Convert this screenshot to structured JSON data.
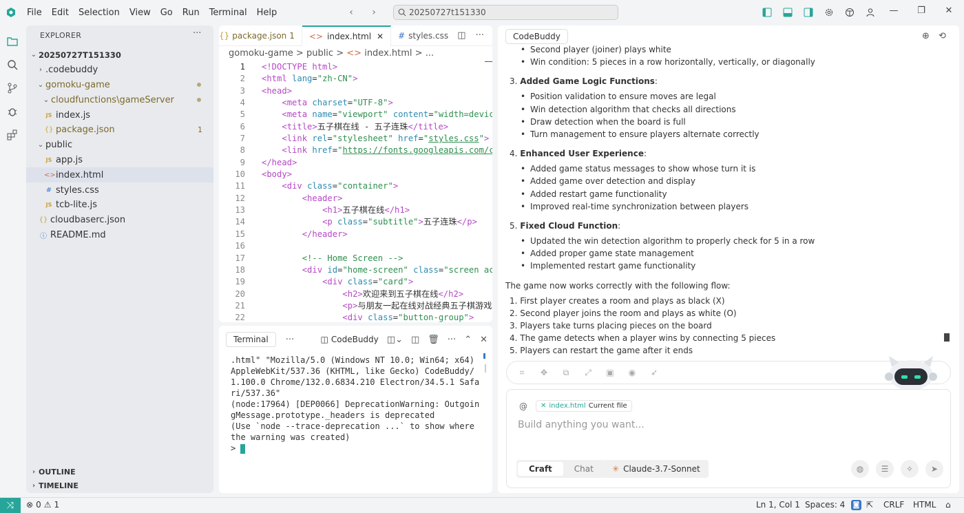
{
  "menu": [
    "File",
    "Edit",
    "Selection",
    "View",
    "Go",
    "Run",
    "Terminal",
    "Help"
  ],
  "search": {
    "text": "20250727t151330"
  },
  "explorer": {
    "title": "EXPLORER",
    "root": "20250727T151330",
    "items": [
      {
        "label": ".codebuddy",
        "icon": "chevron-right"
      },
      {
        "label": "gomoku-game",
        "icon": "chevron-down"
      },
      {
        "label": "cloudfunctions\\gameServer",
        "icon": "chevron-down"
      },
      {
        "label": "index.js",
        "icon": "js"
      },
      {
        "label": "package.json",
        "icon": "json",
        "count": "1"
      },
      {
        "label": "public",
        "icon": "chevron-down"
      },
      {
        "label": "app.js",
        "icon": "js"
      },
      {
        "label": "index.html",
        "icon": "html"
      },
      {
        "label": "styles.css",
        "icon": "css"
      },
      {
        "label": "tcb-lite.js",
        "icon": "js"
      },
      {
        "label": "cloudbaserc.json",
        "icon": "json"
      },
      {
        "label": "README.md",
        "icon": "info"
      }
    ],
    "outline": "OUTLINE",
    "timeline": "TIMELINE"
  },
  "editor": {
    "tabs": [
      "package.json",
      "1",
      "index.html",
      "styles.css"
    ],
    "breadcrumb": [
      "gomoku-game",
      ">",
      "public",
      ">",
      "index.html",
      ">",
      "..."
    ],
    "lines": [
      "1",
      "2",
      "3",
      "4",
      "5",
      "6",
      "7",
      "8",
      "9",
      "10",
      "11",
      "12",
      "13",
      "14",
      "15",
      "16",
      "17",
      "18",
      "19",
      "20",
      "21",
      "22"
    ]
  },
  "terminal": {
    "tab": "Terminal",
    "codebuddy": "CodeBuddy",
    "output": ".html\" \"Mozilla/5.0 (Windows NT 10.0; Win64; x64) AppleWebKit/537.36 (KHTML, like Gecko) CodeBuddy/1.100.0 Chrome/132.0.6834.210 Electron/34.5.1 Safari/537.36\"\n(node:17964) [DEP0066] DeprecationWarning: OutgoingMessage.prototype._headers is deprecated\n(Use `node --trace-deprecation ...` to show where the warning was created)",
    "prompt": ">"
  },
  "chat": {
    "tab": "CodeBuddy",
    "top_bullets": [
      "Second player (joiner) plays white",
      "Win condition: 5 pieces in a row horizontally, vertically, or diagonally"
    ],
    "s3": {
      "num": "3.",
      "title": "Added Game Logic Functions",
      "colon": ":",
      "items": [
        "Position validation to ensure moves are legal",
        "Win detection algorithm that checks all directions",
        "Draw detection when the board is full",
        "Turn management to ensure players alternate correctly"
      ]
    },
    "s4": {
      "num": "4.",
      "title": "Enhanced User Experience",
      "colon": ":",
      "items": [
        "Added game status messages to show whose turn it is",
        "Added game over detection and display",
        "Added restart game functionality",
        "Improved real-time synchronization between players"
      ]
    },
    "s5": {
      "num": "5.",
      "title": "Fixed Cloud Function",
      "colon": ":",
      "items": [
        "Updated the win detection algorithm to properly check for 5 in a row",
        "Added proper game state management",
        "Implemented restart game functionality"
      ]
    },
    "flow_intro": "The game now works correctly with the following flow:",
    "flow": [
      "1. First player creates a room and plays as black (X)",
      "2. Second player joins the room and plays as white (O)",
      "3. Players take turns placing pieces on the board",
      "4. The game detects when a player wins by connecting 5 pieces",
      "5. Players can restart the game after it ends"
    ],
    "context_at": "@",
    "context_file": "index.html",
    "context_label": "Current file",
    "placeholder": "Build anything you want...",
    "mode_craft": "Craft",
    "mode_chat": "Chat",
    "model": "Claude-3.7-Sonnet"
  },
  "status": {
    "errors": "0",
    "warnings": "1",
    "position": "Ln 1, Col 1",
    "spaces": "Spaces: 4",
    "eol": "CRLF",
    "lang": "HTML"
  }
}
